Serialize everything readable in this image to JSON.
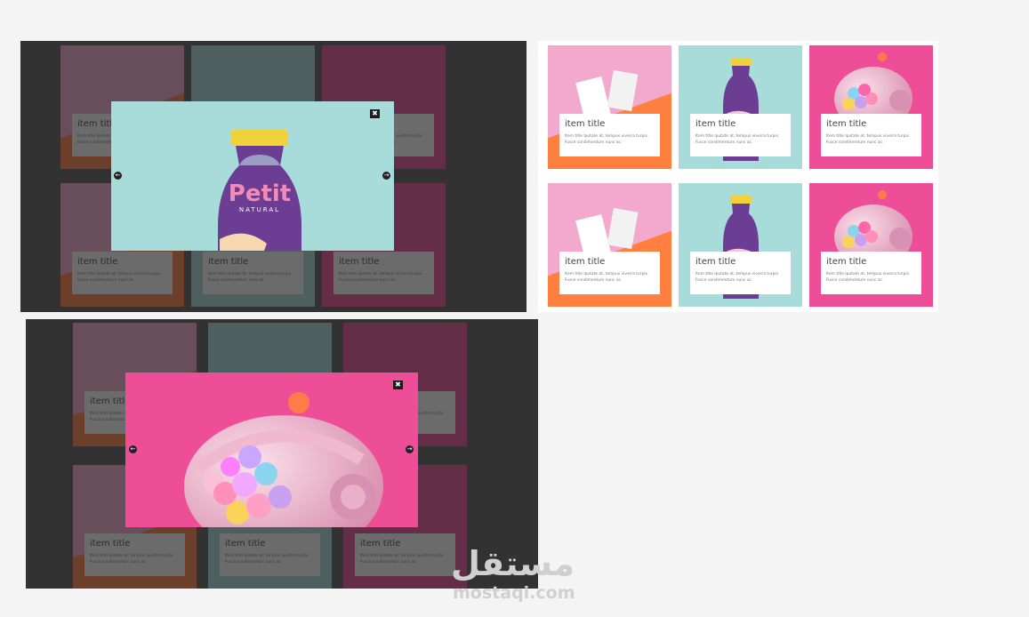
{
  "cards": [
    {
      "title": "item title",
      "desc": "Item title lputate at, tempus viverra turpis. Fusce condimentum nunc ac."
    },
    {
      "title": "item title",
      "desc": "Item title lputate at, tempus viverra turpis. Fusce condimentum nunc ac."
    },
    {
      "title": "item title",
      "desc": "Item title lputate at, tempus viverra turpis. Fusce condimentum nunc ac."
    },
    {
      "title": "item title",
      "desc": "Item title lputate at, tempus viverra turpis. Fusce condimentum nunc ac."
    },
    {
      "title": "item title",
      "desc": "Item title lputate at, tempus viverra turpis. Fusce condimentum nunc ac."
    },
    {
      "title": "item title",
      "desc": "Item title lputate at, tempus viverra turpis. Fusce condimentum nunc ac."
    }
  ],
  "bottle": {
    "brand": "Petit",
    "sub": "NATURAL"
  },
  "modal": {
    "prev_glyph": "←",
    "next_glyph": "→",
    "close_glyph": "✖"
  },
  "watermark": {
    "arabic": "مستقل",
    "latin": "mostaqi.com"
  },
  "colors": {
    "pink": "#f3a9cd",
    "orange": "#ff7f3f",
    "teal": "#a8dcdb",
    "magenta": "#ee4d98",
    "overlay": "#4a4a4a"
  }
}
